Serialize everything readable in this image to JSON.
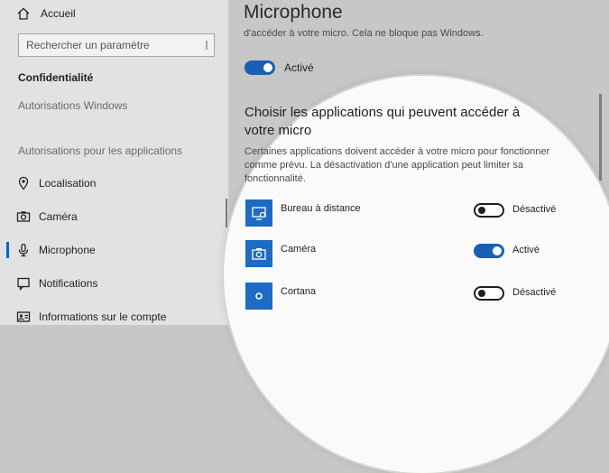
{
  "sidebar": {
    "home_label": "Accueil",
    "search_placeholder": "Rechercher un paramètre",
    "section_title": "Confidentialité",
    "windows_permissions": "Autorisations Windows",
    "app_permissions": "Autorisations pour les applications",
    "items": [
      {
        "label": "Localisation",
        "icon": "location-icon",
        "selected": false
      },
      {
        "label": "Caméra",
        "icon": "camera-icon",
        "selected": false
      },
      {
        "label": "Microphone",
        "icon": "microphone-icon",
        "selected": true
      },
      {
        "label": "Notifications",
        "icon": "notifications-icon",
        "selected": false
      },
      {
        "label": "Informations sur le compte",
        "icon": "account-info-icon",
        "selected": false
      }
    ]
  },
  "main": {
    "title": "Microphone",
    "subtitle": "d'accéder à votre micro. Cela ne bloque pas Windows.",
    "master_toggle": {
      "state": "on",
      "label": "Activé"
    },
    "section_heading": "Choisir les applications qui peuvent accéder à votre micro",
    "section_desc": "Certaines applications doivent accéder à votre micro pour fonctionner comme prévu. La désactivation d'une application peut limiter sa fonctionnalité.",
    "apps": [
      {
        "name": "Bureau à distance",
        "icon": "remote-desktop-icon",
        "state": "off",
        "status": "Désactivé"
      },
      {
        "name": "Caméra",
        "icon": "camera-app-icon",
        "state": "on",
        "status": "Activé"
      },
      {
        "name": "Cortana",
        "icon": "cortana-icon",
        "state": "off",
        "status": "Désactivé"
      }
    ]
  },
  "colors": {
    "accent": "#1a5fb4",
    "tile": "#1e6bc4",
    "sidebar_bg": "#e2e2e2",
    "page_bg": "#c7c7c7",
    "magnifier_bg": "#fafafa"
  }
}
